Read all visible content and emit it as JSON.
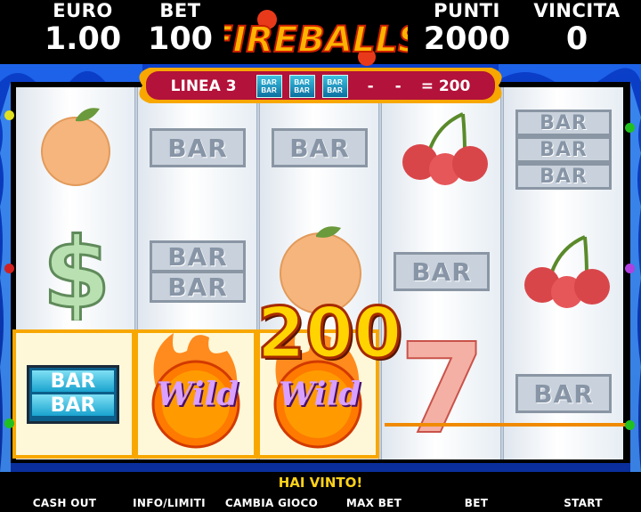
{
  "header": {
    "euro": {
      "label": "EURO",
      "value": "1.00"
    },
    "bet": {
      "label": "BET",
      "value": "100"
    },
    "points": {
      "label": "PUNTI",
      "value": "2000"
    },
    "win": {
      "label": "VINCITA",
      "value": "0"
    },
    "logo_text": "FIREBALLS"
  },
  "banner": {
    "line_label": "LINEA 3",
    "mini_symbol": "BAR",
    "dash1": "-",
    "dash2": "-",
    "equals_value": "= 200"
  },
  "reels": {
    "bar_label": "BAR",
    "wild_label": "Wild",
    "seven_label": "7",
    "win_amount": "200",
    "symbols": [
      [
        "orange",
        "dollar",
        "bar-bar (win)"
      ],
      [
        "bar",
        "bar-bar",
        "wild (win)"
      ],
      [
        "bar",
        "orange",
        "wild (win)"
      ],
      [
        "cherries",
        "bar",
        "seven"
      ],
      [
        "bar-bar-bar",
        "cherries",
        "bar"
      ]
    ]
  },
  "colors": {
    "frame_blue": "#0b3fc9",
    "banner_red": "#b3123a",
    "win_gold": "#f7a700",
    "status_yellow": "#ffd21a"
  },
  "status_text": "HAI VINTO!",
  "buttons": {
    "cash_out": "CASH OUT",
    "info": "INFO/LIMITI",
    "change_game": "CAMBIA GIOCO",
    "max_bet": "MAX BET",
    "bet": "BET",
    "start": "START"
  }
}
